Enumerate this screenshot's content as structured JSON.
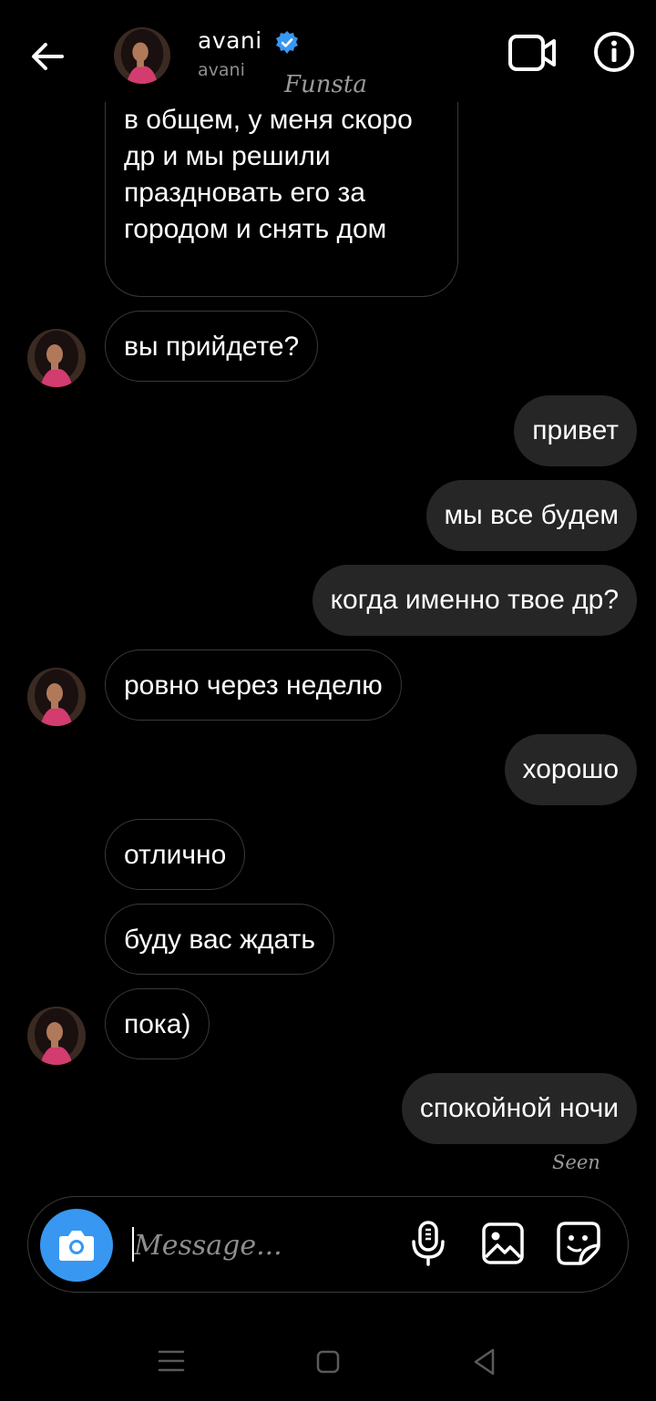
{
  "header": {
    "name": "avani",
    "username": "avani",
    "tag": "Funsta"
  },
  "messages": [
    {
      "from": "them",
      "text": "в общем, у меня скоро др и мы решили праздновать его за городом и снять дом"
    },
    {
      "from": "them",
      "text": "вы прийдете?"
    },
    {
      "from": "me",
      "text": "привет"
    },
    {
      "from": "me",
      "text": "мы все будем"
    },
    {
      "from": "me",
      "text": "когда именно твое др?"
    },
    {
      "from": "them",
      "text": "ровно через неделю"
    },
    {
      "from": "me",
      "text": "хорошо"
    },
    {
      "from": "them",
      "text": "отлично"
    },
    {
      "from": "them",
      "text": "буду вас ждать"
    },
    {
      "from": "them",
      "text": "пока)"
    },
    {
      "from": "me",
      "text": "спокойной ночи"
    }
  ],
  "seen_label": "Seen",
  "composer": {
    "placeholder": "Message..."
  },
  "icons": {
    "back": "arrow-left-icon",
    "verified": "verified-badge-icon",
    "video": "video-call-icon",
    "info": "info-icon",
    "camera": "camera-icon",
    "mic": "microphone-icon",
    "gallery": "gallery-icon",
    "sticker": "sticker-icon"
  },
  "colors": {
    "background": "#000000",
    "outgoing_bubble": "#262626",
    "incoming_border": "#3a3a3a",
    "accent": "#3897f0",
    "secondary_text": "#8e8e8e"
  }
}
